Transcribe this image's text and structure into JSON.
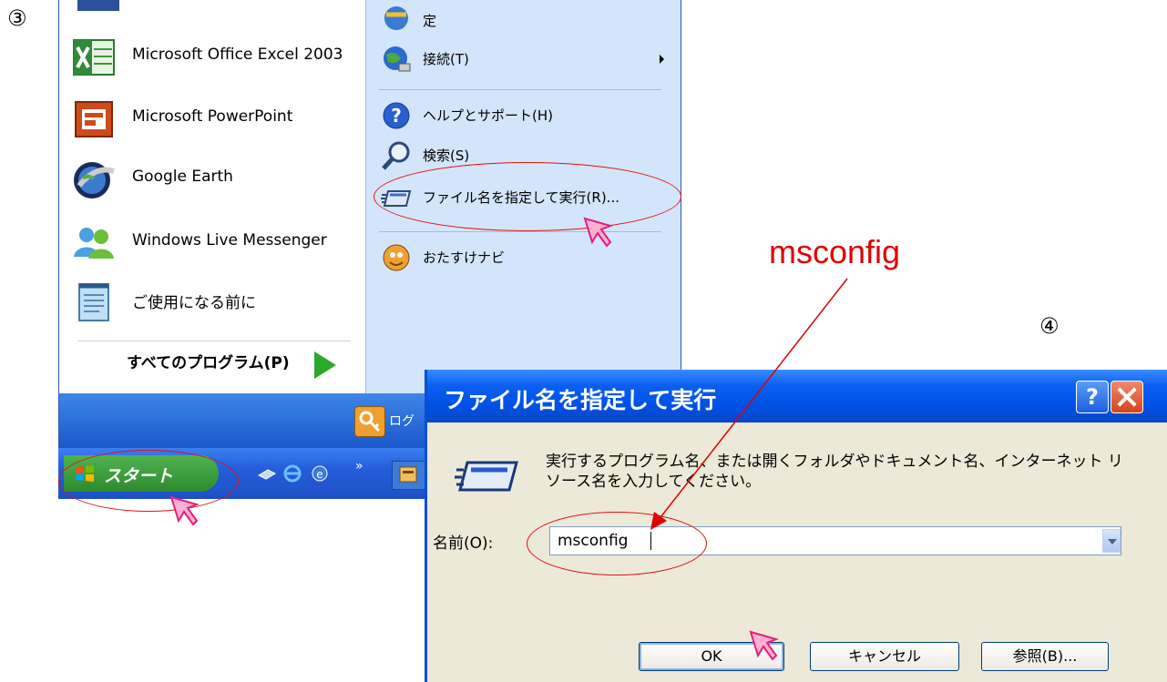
{
  "steps": {
    "three": "③",
    "four": "④"
  },
  "start_menu": {
    "left_items": [
      {
        "label": "Microsoft Office Excel 2003",
        "icon": "excel-icon"
      },
      {
        "label": "Microsoft PowerPoint",
        "icon": "powerpoint-icon"
      },
      {
        "label": "Google Earth",
        "icon": "google-earth-icon"
      },
      {
        "label": "Windows Live Messenger",
        "icon": "messenger-icon"
      },
      {
        "label": "ご使用になる前に",
        "icon": "notepad-icon"
      }
    ],
    "all_programs": "すべてのプログラム(P)",
    "right_items": [
      {
        "label": "定",
        "icon": "program-access-icon"
      },
      {
        "label": "接続(T)",
        "icon": "connect-icon"
      },
      {
        "label": "ヘルプとサポート(H)",
        "icon": "help-icon"
      },
      {
        "label": "検索(S)",
        "icon": "search-icon"
      },
      {
        "label": "ファイル名を指定して実行(R)...",
        "icon": "run-icon"
      },
      {
        "label": "おたすけナビ",
        "icon": "navi-icon"
      }
    ],
    "logoff_label": "ログ"
  },
  "taskbar": {
    "start_label": "スタート",
    "chevron": "»"
  },
  "annotation": {
    "msconfig": "msconfig"
  },
  "dialog": {
    "title": "ファイル名を指定して実行",
    "help_label": "?",
    "prompt": "実行するプログラム名、または開くフォルダやドキュメント名、インターネット リソース名を入力してください。",
    "name_label": "名前(O):",
    "name_value": "msconfig",
    "ok_label": "OK",
    "cancel_label": "キャンセル",
    "browse_label": "参照(B)..."
  },
  "colors": {
    "annotation_red": "#e00000",
    "xp_blue": "#0050e6",
    "start_green": "#2e8b2e"
  }
}
